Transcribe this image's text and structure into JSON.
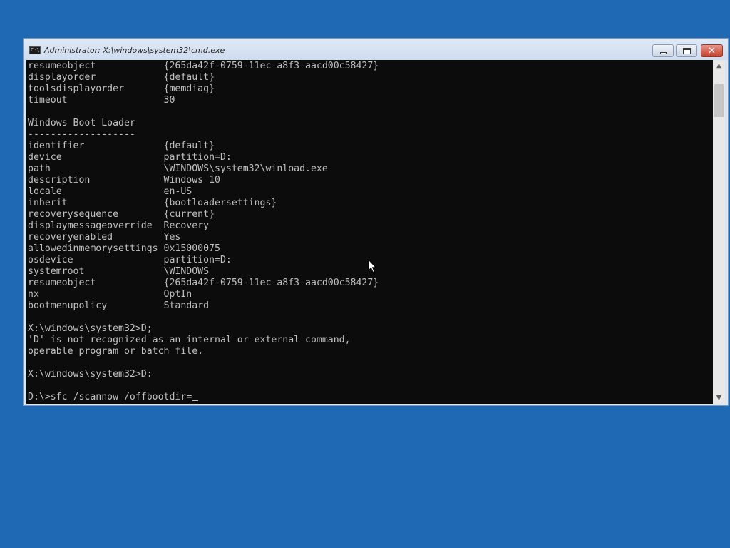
{
  "window": {
    "title": "Administrator: X:\\windows\\system32\\cmd.exe",
    "icon": "cmd-icon",
    "icon_text": "C:\\"
  },
  "controls": {
    "minimize": "minimize-icon",
    "maximize": "maximize-icon",
    "close": "close-icon",
    "close_glyph": "✕"
  },
  "console": {
    "lines": [
      "resumeobject            {265da42f-0759-11ec-a8f3-aacd00c58427}",
      "displayorder            {default}",
      "toolsdisplayorder       {memdiag}",
      "timeout                 30",
      "",
      "Windows Boot Loader",
      "-------------------",
      "identifier              {default}",
      "device                  partition=D:",
      "path                    \\WINDOWS\\system32\\winload.exe",
      "description             Windows 10",
      "locale                  en-US",
      "inherit                 {bootloadersettings}",
      "recoverysequence        {current}",
      "displaymessageoverride  Recovery",
      "recoveryenabled         Yes",
      "allowedinmemorysettings 0x15000075",
      "osdevice                partition=D:",
      "systemroot              \\WINDOWS",
      "resumeobject            {265da42f-0759-11ec-a8f3-aacd00c58427}",
      "nx                      OptIn",
      "bootmenupolicy          Standard",
      "",
      "X:\\windows\\system32>D;",
      "'D' is not recognized as an internal or external command,",
      "operable program or batch file.",
      "",
      "X:\\windows\\system32>D:",
      ""
    ],
    "prompt": "D:\\>",
    "input": "sfc /scannow /offbootdir="
  },
  "scrollbar": {
    "up_arrow": "▲",
    "down_arrow": "▼"
  },
  "colors": {
    "desktop": "#1f68b4",
    "console_bg": "#0c0c0c",
    "console_text": "#c0c0c0"
  }
}
